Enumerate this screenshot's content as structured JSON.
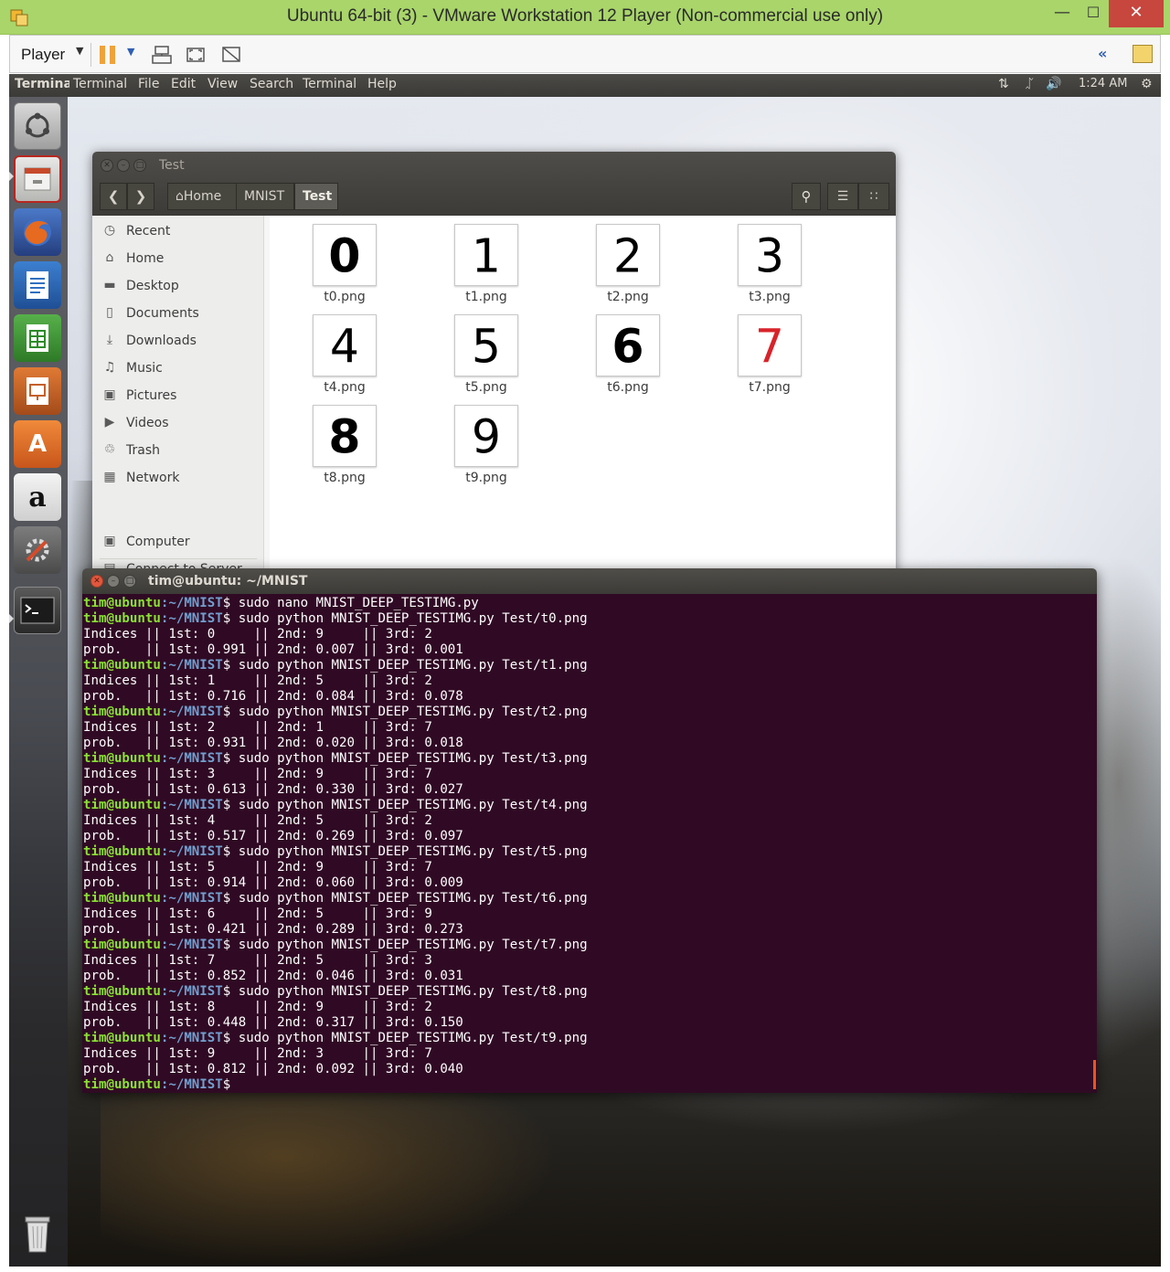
{
  "vmware": {
    "title": "Ubuntu 64-bit (3) - VMware Workstation 12 Player (Non-commercial use only)",
    "player_menu": "Player"
  },
  "panel": {
    "app_name": "Terminal",
    "menus": [
      "Terminal",
      "File",
      "Edit",
      "View",
      "Search",
      "Terminal",
      "Help"
    ],
    "clock": "1:24 AM"
  },
  "launcher": {
    "items": [
      "ubuntu-dash-icon",
      "files-icon",
      "firefox-icon",
      "writer-icon",
      "calc-icon",
      "impress-icon",
      "software-center-icon",
      "amazon-icon",
      "system-settings-icon",
      "terminal-icon"
    ],
    "trash": "trash-icon"
  },
  "file_manager": {
    "title": "Test",
    "breadcrumb": [
      "Home",
      "MNIST",
      "Test"
    ],
    "sidebar": [
      {
        "label": "Recent",
        "icon": "clock-icon"
      },
      {
        "label": "Home",
        "icon": "home-icon"
      },
      {
        "label": "Desktop",
        "icon": "folder-icon"
      },
      {
        "label": "Documents",
        "icon": "document-icon"
      },
      {
        "label": "Downloads",
        "icon": "download-icon"
      },
      {
        "label": "Music",
        "icon": "music-icon"
      },
      {
        "label": "Pictures",
        "icon": "camera-icon"
      },
      {
        "label": "Videos",
        "icon": "video-icon"
      },
      {
        "label": "Trash",
        "icon": "trash-icon"
      },
      {
        "label": "Network",
        "icon": "network-icon"
      },
      {
        "label": "Computer",
        "icon": "computer-icon"
      },
      {
        "label": "Connect to Server",
        "icon": "server-icon"
      }
    ],
    "files": [
      {
        "name": "t0.png",
        "digit": "0",
        "color": "#000000"
      },
      {
        "name": "t1.png",
        "digit": "1",
        "color": "#000000"
      },
      {
        "name": "t2.png",
        "digit": "2",
        "color": "#000000"
      },
      {
        "name": "t3.png",
        "digit": "3",
        "color": "#000000"
      },
      {
        "name": "t4.png",
        "digit": "4",
        "color": "#000000"
      },
      {
        "name": "t5.png",
        "digit": "5",
        "color": "#000000"
      },
      {
        "name": "t6.png",
        "digit": "6",
        "color": "#000000"
      },
      {
        "name": "t7.png",
        "digit": "7",
        "color": "#d8232a"
      },
      {
        "name": "t8.png",
        "digit": "8",
        "color": "#000000"
      },
      {
        "name": "t9.png",
        "digit": "9",
        "color": "#000000"
      }
    ]
  },
  "terminal": {
    "title": "tim@ubuntu: ~/MNIST",
    "prompt_user": "tim@ubuntu",
    "prompt_path": ":~/MNIST",
    "prompt_symbol": "$",
    "lines": [
      {
        "type": "prompt",
        "cmd": " sudo nano MNIST_DEEP_TESTIMG.py"
      },
      {
        "type": "prompt",
        "cmd": " sudo python MNIST_DEEP_TESTIMG.py Test/t0.png"
      },
      {
        "type": "out",
        "text": "Indices || 1st: 0     || 2nd: 9     || 3rd: 2"
      },
      {
        "type": "out",
        "text": "prob.   || 1st: 0.991 || 2nd: 0.007 || 3rd: 0.001"
      },
      {
        "type": "prompt",
        "cmd": " sudo python MNIST_DEEP_TESTIMG.py Test/t1.png"
      },
      {
        "type": "out",
        "text": "Indices || 1st: 1     || 2nd: 5     || 3rd: 2"
      },
      {
        "type": "out",
        "text": "prob.   || 1st: 0.716 || 2nd: 0.084 || 3rd: 0.078"
      },
      {
        "type": "prompt",
        "cmd": " sudo python MNIST_DEEP_TESTIMG.py Test/t2.png"
      },
      {
        "type": "out",
        "text": "Indices || 1st: 2     || 2nd: 1     || 3rd: 7"
      },
      {
        "type": "out",
        "text": "prob.   || 1st: 0.931 || 2nd: 0.020 || 3rd: 0.018"
      },
      {
        "type": "prompt",
        "cmd": " sudo python MNIST_DEEP_TESTIMG.py Test/t3.png"
      },
      {
        "type": "out",
        "text": "Indices || 1st: 3     || 2nd: 9     || 3rd: 7"
      },
      {
        "type": "out",
        "text": "prob.   || 1st: 0.613 || 2nd: 0.330 || 3rd: 0.027"
      },
      {
        "type": "prompt",
        "cmd": " sudo python MNIST_DEEP_TESTIMG.py Test/t4.png"
      },
      {
        "type": "out",
        "text": "Indices || 1st: 4     || 2nd: 5     || 3rd: 2"
      },
      {
        "type": "out",
        "text": "prob.   || 1st: 0.517 || 2nd: 0.269 || 3rd: 0.097"
      },
      {
        "type": "prompt",
        "cmd": " sudo python MNIST_DEEP_TESTIMG.py Test/t5.png"
      },
      {
        "type": "out",
        "text": "Indices || 1st: 5     || 2nd: 9     || 3rd: 7"
      },
      {
        "type": "out",
        "text": "prob.   || 1st: 0.914 || 2nd: 0.060 || 3rd: 0.009"
      },
      {
        "type": "prompt",
        "cmd": " sudo python MNIST_DEEP_TESTIMG.py Test/t6.png"
      },
      {
        "type": "out",
        "text": "Indices || 1st: 6     || 2nd: 5     || 3rd: 9"
      },
      {
        "type": "out",
        "text": "prob.   || 1st: 0.421 || 2nd: 0.289 || 3rd: 0.273"
      },
      {
        "type": "prompt",
        "cmd": " sudo python MNIST_DEEP_TESTIMG.py Test/t7.png"
      },
      {
        "type": "out",
        "text": "Indices || 1st: 7     || 2nd: 5     || 3rd: 3"
      },
      {
        "type": "out",
        "text": "prob.   || 1st: 0.852 || 2nd: 0.046 || 3rd: 0.031"
      },
      {
        "type": "prompt",
        "cmd": " sudo python MNIST_DEEP_TESTIMG.py Test/t8.png"
      },
      {
        "type": "out",
        "text": "Indices || 1st: 8     || 2nd: 9     || 3rd: 2"
      },
      {
        "type": "out",
        "text": "prob.   || 1st: 0.448 || 2nd: 0.317 || 3rd: 0.150"
      },
      {
        "type": "prompt",
        "cmd": " sudo python MNIST_DEEP_TESTIMG.py Test/t9.png"
      },
      {
        "type": "out",
        "text": "Indices || 1st: 9     || 2nd: 3     || 3rd: 7"
      },
      {
        "type": "out",
        "text": "prob.   || 1st: 0.812 || 2nd: 0.092 || 3rd: 0.040"
      },
      {
        "type": "prompt",
        "cmd": ""
      }
    ]
  }
}
